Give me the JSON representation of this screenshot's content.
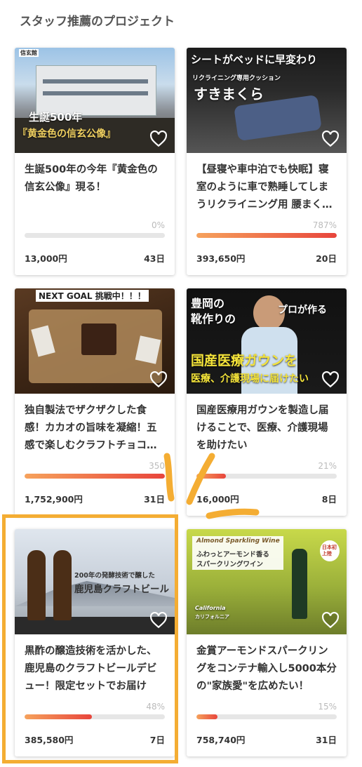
{
  "section": {
    "title": "スタッフ推薦のプロジェクト"
  },
  "colors": {
    "accent": "#f4ad33",
    "progress_start": "#f6a25c",
    "progress_end": "#e8453c"
  },
  "cards": [
    {
      "title": "生誕500年の今年『黄金色の信玄公像』現る！",
      "percent": "0%",
      "progress": 0.0,
      "amount": "13,000円",
      "days": "43日",
      "image_text": [
        "信玄館",
        "生誕500年",
        "『黄金色の信玄公像』"
      ]
    },
    {
      "title": "【昼寝や車中泊でも快眠】寝室のように車で熟睡してしまうリクライニング用 腰まく…",
      "percent": "787%",
      "progress": 1.0,
      "amount": "393,650円",
      "days": "20日",
      "image_text": [
        "シートがベッドに早変わり",
        "リクライニング専用クッション",
        "すきまくら"
      ]
    },
    {
      "title": "独自製法でザクザクした食感！カカオの旨味を凝縮！五感で楽しむクラフトチョコ…",
      "percent": "350",
      "progress": 1.0,
      "amount": "1,752,900円",
      "days": "31日",
      "image_text": [
        "NEXT GOAL 挑戦中！！！"
      ]
    },
    {
      "title": "国産医療用ガウンを製造し届けることで、医療、介護現場を助けたい",
      "percent": "21%",
      "progress": 0.21,
      "amount": "16,000円",
      "days": "8日",
      "image_text": [
        "豊岡の",
        "靴作りの",
        "プロが作る",
        "国産医療ガウンを",
        "医療、介護現場に届けたい"
      ]
    },
    {
      "title": "黒酢の醸造技術を活かした、鹿児島のクラフトビールデビュー！限定セットでお届け",
      "percent": "48%",
      "progress": 0.48,
      "amount": "385,580円",
      "days": "7日",
      "image_text": [
        "200年の発酵技術で醸した",
        "鹿児島クラフトビール"
      ]
    },
    {
      "title": "金賞アーモンドスパークリングをコンテナ輸入し5000本分の\"家族愛\"を広めたい！",
      "percent": "15%",
      "progress": 0.15,
      "amount": "758,740円",
      "days": "31日",
      "image_text": [
        "Almond Sparkling Wine",
        "ふわっとアーモンド香る",
        "スパークリングワイン",
        "日本初上陸",
        "California",
        "カリフォルニア"
      ]
    }
  ]
}
